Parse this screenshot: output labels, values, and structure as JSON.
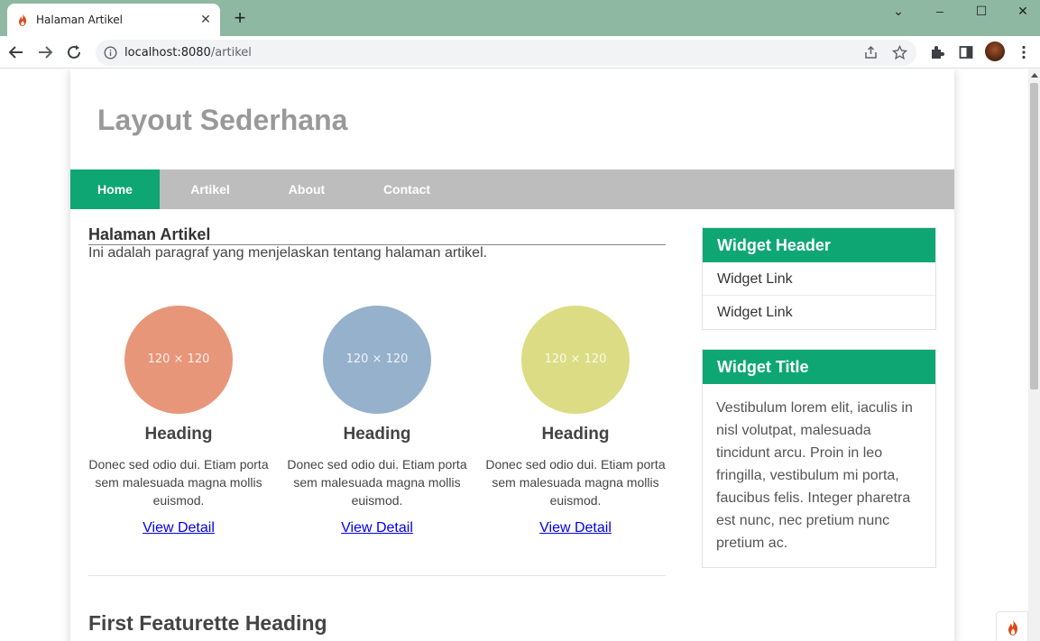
{
  "browser": {
    "tab_title": "Halaman Artikel",
    "url_host": "localhost:8080",
    "url_path": "/artikel"
  },
  "site": {
    "title": "Layout Sederhana",
    "nav": [
      "Home",
      "Artikel",
      "About",
      "Contact"
    ],
    "active_nav": "Home"
  },
  "article": {
    "title": "Halaman Artikel",
    "paragraph": "Ini adalah paragraf yang menjelaskan tentang halaman artikel."
  },
  "features": [
    {
      "placeholder": "120 × 120",
      "color": "#e8967a",
      "heading": "Heading",
      "text": "Donec sed odio dui. Etiam porta sem malesuada magna mollis euismod.",
      "link": "View Detail"
    },
    {
      "placeholder": "120 × 120",
      "color": "#96b1cc",
      "heading": "Heading",
      "text": "Donec sed odio dui. Etiam porta sem malesuada magna mollis euismod.",
      "link": "View Detail"
    },
    {
      "placeholder": "120 × 120",
      "color": "#dcdc84",
      "heading": "Heading",
      "text": "Donec sed odio dui. Etiam porta sem malesuada magna mollis euismod.",
      "link": "View Detail"
    }
  ],
  "featurette": {
    "heading": "First Featurette Heading"
  },
  "sidebar": {
    "widget1": {
      "header": "Widget Header",
      "links": [
        "Widget Link",
        "Widget Link"
      ]
    },
    "widget2": {
      "title": "Widget Title",
      "body": "Vestibulum lorem elit, iaculis in nisl volutpat, malesuada tincidunt arcu. Proin in leo fringilla, vestibulum mi porta, faucibus felis. Integer pharetra est nunc, nec pretium nunc pretium ac."
    }
  },
  "colors": {
    "accent": "#0ea774",
    "nav_bg": "#bdbdbd",
    "chrome": "#8fb8a3"
  },
  "icons": [
    "codeigniter-flame-icon",
    "close-icon",
    "plus-icon",
    "chevron-down-icon",
    "minimize-icon",
    "maximize-icon",
    "window-close-icon",
    "back-arrow-icon",
    "forward-arrow-icon",
    "reload-icon",
    "info-icon",
    "share-icon",
    "star-icon",
    "extensions-icon",
    "sidepanel-icon",
    "menu-dots-icon"
  ]
}
